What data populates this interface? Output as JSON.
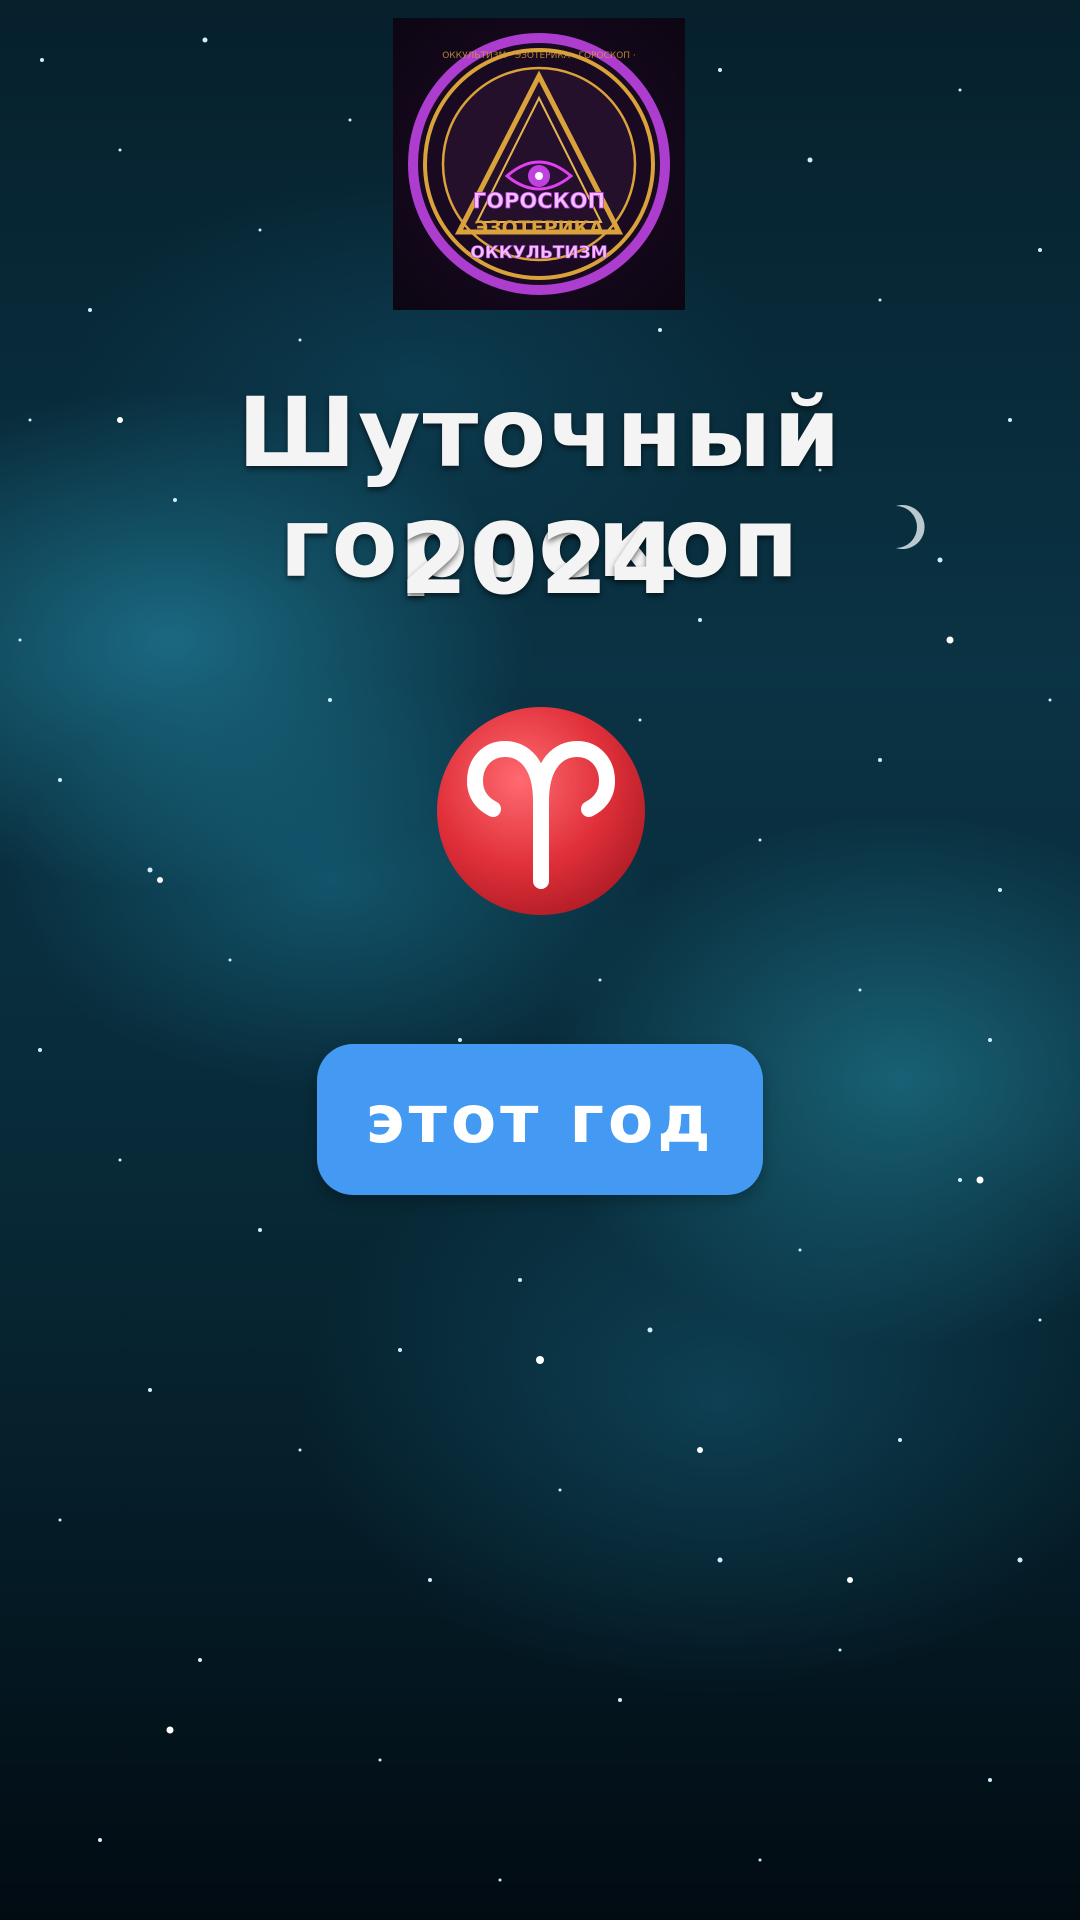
{
  "logo": {
    "line1": "ГОРОСКОП",
    "line2": "ЭЗОТЕРИКА",
    "line3": "ОККУЛЬТИЗМ",
    "ring_text": "ОККУЛЬТИЗМ · ЭЗОТЕРИКА · ГОРОСКОП ·",
    "icon": "all-seeing-eye-icon",
    "accent_color": "#c040e0",
    "gold_color": "#d9a23a"
  },
  "title": {
    "line1": "Шуточный гороскоп",
    "line2": "2024"
  },
  "zodiac": {
    "icon": "aries-icon",
    "color": "#e0303a"
  },
  "cta": {
    "label": "этот год",
    "color": "#4499f2"
  }
}
